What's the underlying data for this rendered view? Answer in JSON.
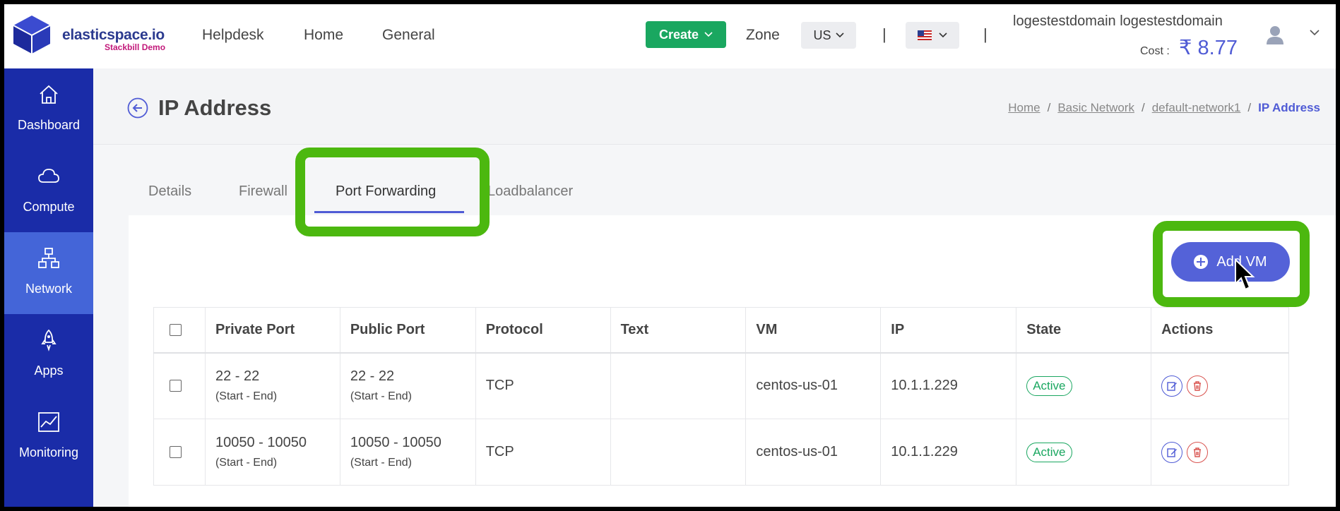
{
  "brand": {
    "name": "elasticspace.io",
    "subtitle": "Stackbill Demo"
  },
  "nav": {
    "helpdesk": "Helpdesk",
    "home": "Home",
    "general": "General"
  },
  "header": {
    "create_label": "Create",
    "zone_label": "Zone",
    "zone_value": "US",
    "divider": "|",
    "user_name": "logestestdomain logestestdomain",
    "cost_label": "Cost :",
    "currency": "₹",
    "cost_value": "8.77"
  },
  "sidebar": {
    "items": [
      {
        "label": "Dashboard",
        "icon": "home-icon"
      },
      {
        "label": "Compute",
        "icon": "cloud-icon"
      },
      {
        "label": "Network",
        "icon": "network-icon",
        "active": true
      },
      {
        "label": "Apps",
        "icon": "rocket-icon"
      },
      {
        "label": "Monitoring",
        "icon": "chart-icon"
      }
    ]
  },
  "page": {
    "title": "IP Address",
    "breadcrumb": [
      "Home",
      "Basic Network",
      "default-network1",
      "IP Address"
    ],
    "breadcrumb_sep": "/"
  },
  "tabs": [
    {
      "label": "Details"
    },
    {
      "label": "Firewall"
    },
    {
      "label": "Port Forwarding",
      "active": true
    },
    {
      "label": "Loadbalancer"
    }
  ],
  "add_vm_label": "Add VM",
  "table": {
    "headers": [
      "Private Port",
      "Public Port",
      "Protocol",
      "Text",
      "VM",
      "IP",
      "State",
      "Actions"
    ],
    "rows": [
      {
        "private": "22 - 22",
        "private_sub": "(Start - End)",
        "public": "22 - 22",
        "public_sub": "(Start - End)",
        "protocol": "TCP",
        "text": "",
        "vm": "centos-us-01",
        "ip": "10.1.1.229",
        "state": "Active"
      },
      {
        "private": "10050 - 10050",
        "private_sub": "(Start - End)",
        "public": "10050 - 10050",
        "public_sub": "(Start - End)",
        "protocol": "TCP",
        "text": "",
        "vm": "centos-us-01",
        "ip": "10.1.1.229",
        "state": "Active"
      }
    ]
  },
  "colors": {
    "sidebar": "#1a2ca8",
    "sidebar_active": "#4465d8",
    "accent": "#4f5bd5",
    "create": "#1aa760",
    "highlight": "#4cb80f",
    "danger": "#d9534f"
  }
}
